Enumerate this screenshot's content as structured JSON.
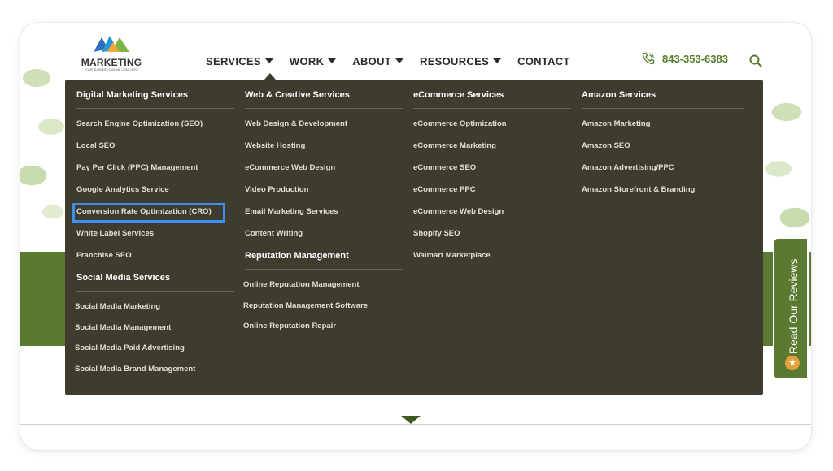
{
  "logo": {
    "text": "MARKETING",
    "tagline": "YOUR BUSINESS TAGLINE GOES HERE"
  },
  "nav": {
    "items": [
      {
        "label": "SERVICES",
        "dropdown": true
      },
      {
        "label": "WORK",
        "dropdown": true
      },
      {
        "label": "ABOUT",
        "dropdown": true
      },
      {
        "label": "RESOURCES",
        "dropdown": true
      },
      {
        "label": "CONTACT",
        "dropdown": false
      }
    ],
    "phone": "843-353-6383"
  },
  "mega_menu": {
    "digital": {
      "title": "Digital Marketing Services",
      "items": [
        "Search Engine Optimization (SEO)",
        "Local SEO",
        "Pay Per Click (PPC) Management",
        "Google Analytics Service",
        "Conversion Rate Optimization (CRO)",
        "White Label Services",
        "Franchise SEO"
      ]
    },
    "social": {
      "title": "Social Media Services",
      "items": [
        "Social Media Marketing",
        "Social Media Management",
        "Social Media Paid Advertising",
        "Social Media Brand Management"
      ]
    },
    "web": {
      "title": "Web & Creative Services",
      "items": [
        "Web Design & Development",
        "Website Hosting",
        "eCommerce Web Design",
        "Video Production",
        "Email Marketing Services",
        "Content Writing"
      ]
    },
    "reputation": {
      "title": "Reputation Management",
      "items": [
        "Online Reputation Management",
        "Reputation Management Software",
        "Online Reputation Repair"
      ]
    },
    "ecommerce": {
      "title": "eCommerce Services",
      "items": [
        "eCommerce Optimization",
        "eCommerce Marketing",
        "eCommerce SEO",
        "eCommerce PPC",
        "eCommerce Web Design",
        "Shopify SEO",
        "Walmart Marketplace"
      ]
    },
    "amazon": {
      "title": "Amazon Services",
      "items": [
        "Amazon Marketing",
        "Amazon SEO",
        "Amazon Advertising/PPC",
        "Amazon Storefront & Branding"
      ]
    },
    "highlighted_item": "Conversion Rate Optimization (CRO)"
  },
  "reviews_tab": {
    "label": "Read Our Reviews"
  },
  "colors": {
    "menu_bg": "#403b2f",
    "brand_green": "#5b7a31",
    "phone_green": "#557d2b",
    "highlight_blue": "#3b8ff0"
  }
}
